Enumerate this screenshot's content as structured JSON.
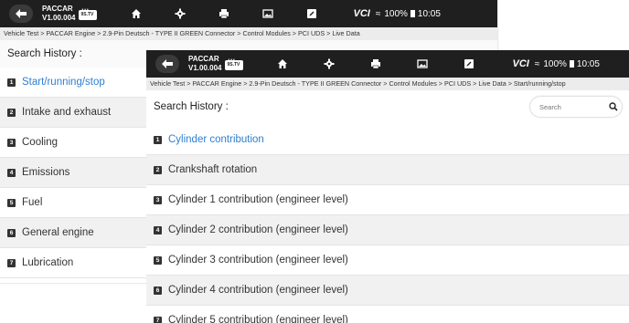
{
  "back_screen": {
    "brand_title": "PACCAR",
    "version": "V1.00.004",
    "vci_label": "VCI",
    "battery": "100%",
    "time": "10:05",
    "breadcrumb": "Vehicle Test > PACCAR Engine > 2.9-Pin Deutsch - TYPE II GREEN Connector > Control Modules > PCI UDS > Live Data",
    "search_history_label": "Search History :",
    "items": [
      {
        "num": "1",
        "label": "Start/running/stop"
      },
      {
        "num": "2",
        "label": "Intake and exhaust"
      },
      {
        "num": "3",
        "label": "Cooling"
      },
      {
        "num": "4",
        "label": "Emissions"
      },
      {
        "num": "5",
        "label": "Fuel"
      },
      {
        "num": "6",
        "label": "General engine"
      },
      {
        "num": "7",
        "label": "Lubrication"
      }
    ]
  },
  "front_screen": {
    "brand_title": "PACCAR",
    "version": "V1.00.004",
    "vci_label": "VCI",
    "battery": "100%",
    "time": "10:05",
    "breadcrumb": "Vehicle Test > PACCAR Engine > 2.9-Pin Deutsch - TYPE II GREEN Connector > Control Modules > PCI UDS > Live Data > Start/running/stop",
    "search_history_label": "Search History :",
    "search_placeholder": "Search",
    "items": [
      {
        "num": "1",
        "label": "Cylinder contribution"
      },
      {
        "num": "2",
        "label": "Crankshaft rotation"
      },
      {
        "num": "3",
        "label": "Cylinder 1 contribution (engineer level)"
      },
      {
        "num": "4",
        "label": "Cylinder 2 contribution (engineer level)"
      },
      {
        "num": "5",
        "label": "Cylinder 3 contribution (engineer level)"
      },
      {
        "num": "6",
        "label": "Cylinder 4 contribution (engineer level)"
      },
      {
        "num": "7",
        "label": "Cylinder 5 contribution (engineer level)"
      }
    ]
  },
  "colors": {
    "topbar": "#1f1f1f",
    "accent": "#2f7fd1",
    "vci_green": "#3fc03f"
  }
}
